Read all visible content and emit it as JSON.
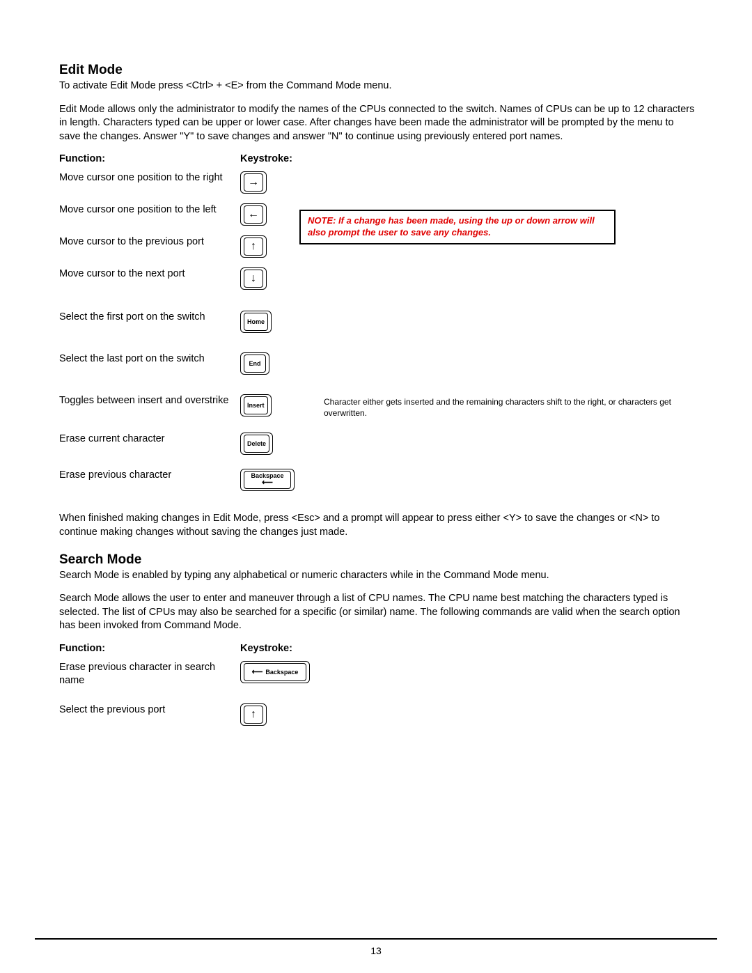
{
  "headings": {
    "edit_mode": "Edit Mode",
    "search_mode": "Search Mode"
  },
  "paragraphs": {
    "p1": "To activate Edit Mode press <Ctrl> + <E> from the Command Mode menu.",
    "p2": "Edit Mode allows only the administrator to modify the names of the CPUs connected to the switch.  Names of CPUs can be up to 12 characters in length.  Characters typed can be upper or lower case.  After changes have been made the administrator will be prompted by the menu to save the changes.  Answer \"Y\" to save changes and answer \"N\" to continue using previously entered port names.",
    "p3": "When finished making changes in Edit Mode, press <Esc> and a prompt will appear to press either <Y> to save the changes or <N> to continue making changes without saving the changes just made.",
    "p4": "Search Mode is enabled by typing any alphabetical or numeric characters while in the Command Mode menu.",
    "p5": "Search Mode allows the user to enter and maneuver through a list of CPU names. The CPU name best matching the characters typed is selected. The list of CPUs may also be searched for a specific (or similar) name. The following commands are valid when the search option has been invoked from Command Mode."
  },
  "col_labels": {
    "function": "Function:",
    "keystroke": "Keystroke:"
  },
  "edit_rows": [
    {
      "fn": "Move cursor one position to the right",
      "key_type": "arrow",
      "key_label": "→"
    },
    {
      "fn": "Move cursor one position to the left",
      "key_type": "arrow",
      "key_label": "←"
    },
    {
      "fn": "Move cursor to the previous port",
      "key_type": "arrow",
      "key_label": "↑"
    },
    {
      "fn": "Move cursor to the next port",
      "key_type": "arrow",
      "key_label": "↓"
    },
    {
      "fn": "Select the first port on the switch",
      "key_type": "text",
      "key_label": "Home"
    },
    {
      "fn": "Select the last port on the switch",
      "key_type": "text",
      "key_label": "End"
    },
    {
      "fn": "Toggles between insert and overstrike",
      "key_type": "text",
      "key_label": "Insert",
      "note": "Character either gets inserted and the remaining characters shift to the right,  or characters get overwritten."
    },
    {
      "fn": "Erase current character",
      "key_type": "text",
      "key_label": "Delete"
    },
    {
      "fn": "Erase previous character",
      "key_type": "backspace",
      "key_label": "Backspace"
    }
  ],
  "search_rows": [
    {
      "fn": "Erase previous character in search name",
      "key_type": "backspace-wide",
      "key_label": "Backspace"
    },
    {
      "fn": "Select the previous port",
      "key_type": "arrow",
      "key_label": "↑"
    }
  ],
  "note_box": "NOTE: If a change has been made, using the up or down arrow will also prompt the user to save any changes.",
  "page_number": "13"
}
